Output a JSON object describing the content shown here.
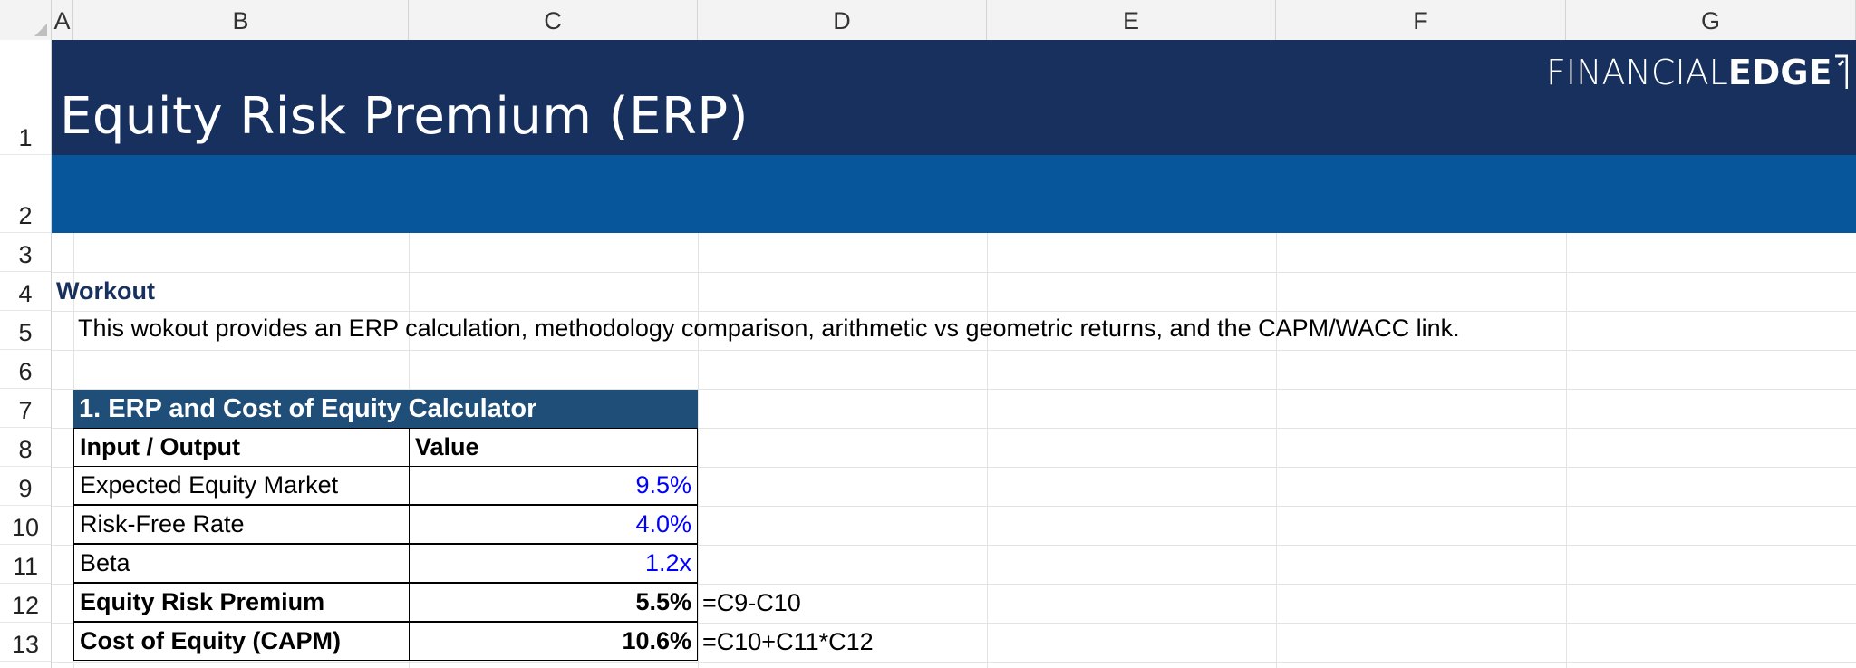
{
  "columns": [
    "A",
    "B",
    "C",
    "D",
    "E",
    "F",
    "G"
  ],
  "rows": [
    "1",
    "2",
    "3",
    "4",
    "5",
    "6",
    "7",
    "8",
    "9",
    "10",
    "11",
    "12",
    "13"
  ],
  "sheet": {
    "title": "Equity Risk Premium (ERP)",
    "logo": {
      "part1": "FINANCIAL",
      "part2": "EDGE"
    },
    "workout_label": "Workout",
    "description": "This wokout provides an ERP calculation, methodology comparison, arithmetic vs geometric returns, and the CAPM/WACC link."
  },
  "calculator": {
    "title": "1. ERP and Cost of Equity Calculator",
    "headers": [
      "Input / Output",
      "Value"
    ],
    "rows": [
      {
        "label": "Expected Equity Market",
        "value": "9.5%",
        "formula": ""
      },
      {
        "label": "Risk-Free Rate",
        "value": "4.0%",
        "formula": ""
      },
      {
        "label": "Beta",
        "value": "1.2x",
        "formula": ""
      },
      {
        "label": "Equity Risk Premium",
        "value": "5.5%",
        "formula": "=C9-C10"
      },
      {
        "label": "Cost of Equity (CAPM)",
        "value": "10.6%",
        "formula": "=C10+C11*C12"
      }
    ]
  },
  "colors": {
    "banner_dark": "#17305e",
    "banner_light": "#07559a",
    "table_header": "#1f4e79",
    "input_blue": "#0000ff"
  }
}
